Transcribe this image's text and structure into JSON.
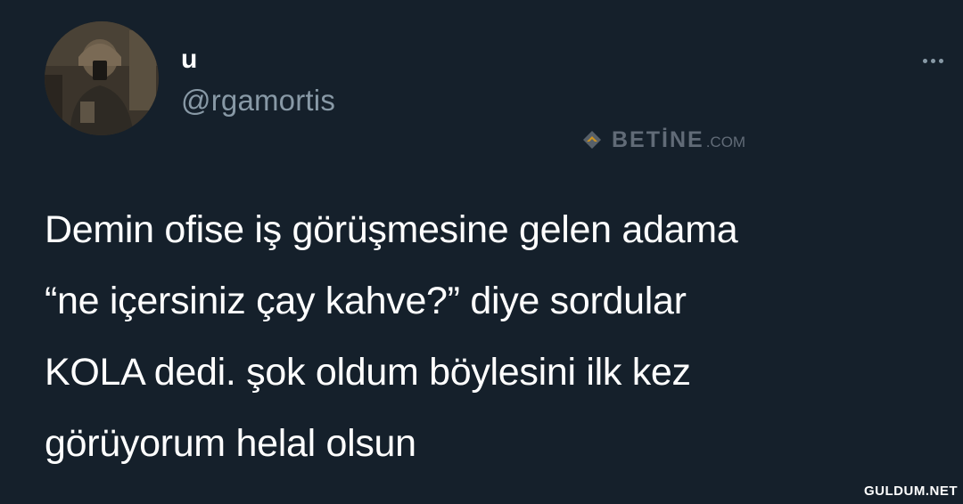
{
  "tweet": {
    "display_name": "u",
    "handle": "@rgamortis",
    "text": "Demin ofise iş görüşmesine gelen adama\n“ne içersiniz çay kahve?” diye sordular\nKOLA dedi. şok oldum böylesini ilk kez\ngörüyorum helal olsun",
    "more_icon": "more-horizontal-icon"
  },
  "watermarks": {
    "top_brand": "BETİNE",
    "top_tld": ".COM",
    "bottom": "GULDUM.NET"
  },
  "colors": {
    "background": "#15202b",
    "text_primary": "#ffffff",
    "text_secondary": "#8899a6"
  }
}
